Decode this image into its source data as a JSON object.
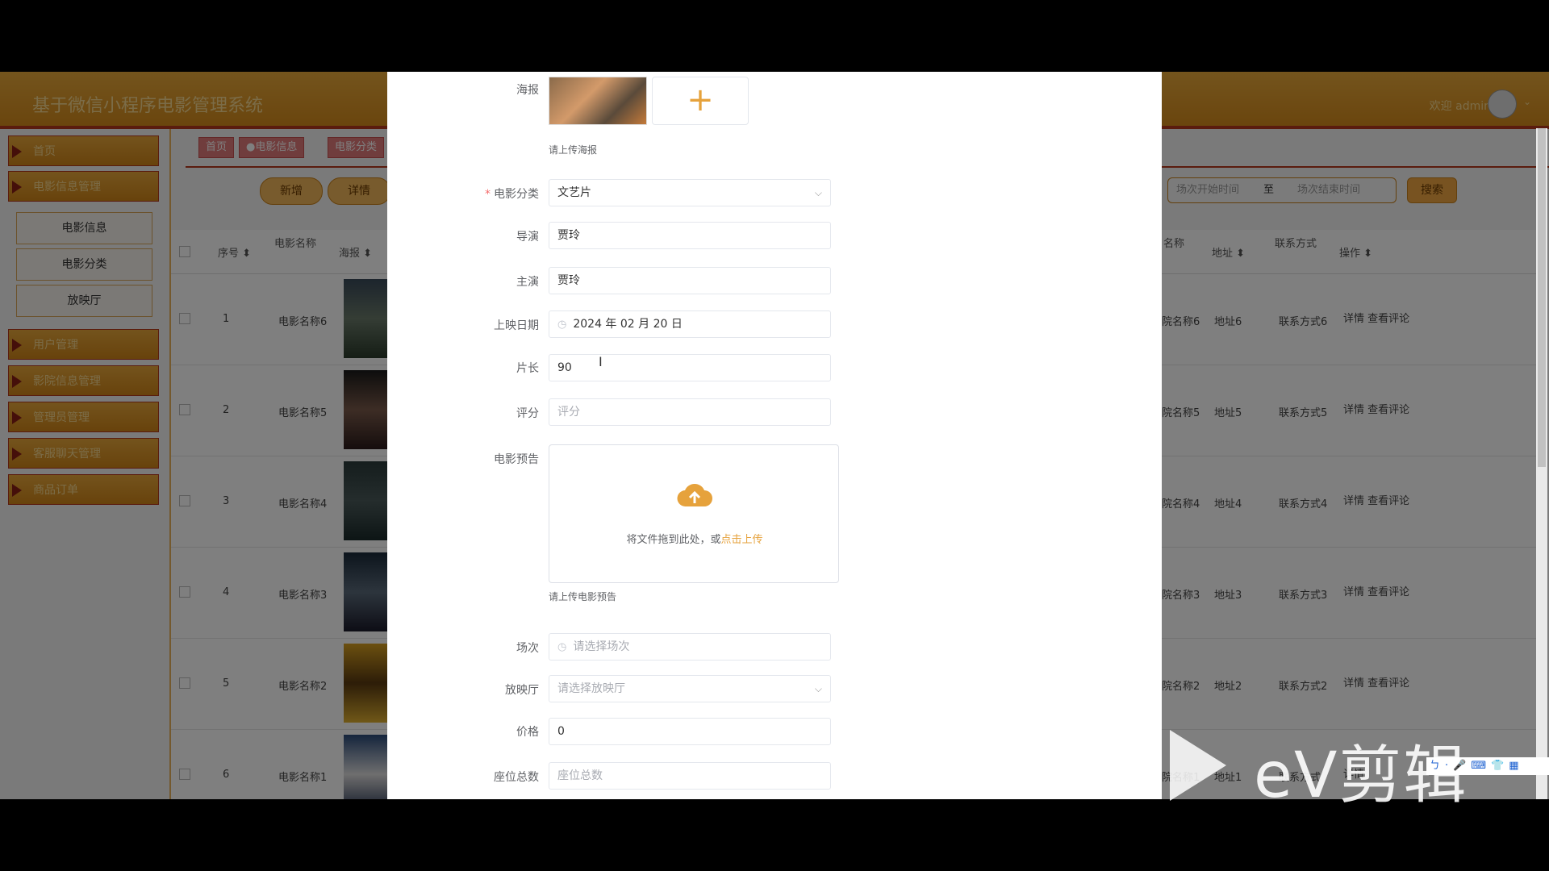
{
  "app": {
    "title": "基于微信小程序电影管理系统",
    "welcome": "欢迎 admin",
    "avatar_arrow": "⌄"
  },
  "sidebar": {
    "home": "首页",
    "movie_mgmt": "电影信息管理",
    "sub_items": [
      "电影信息",
      "电影分类",
      "放映厅"
    ],
    "user_mgmt": "用户管理",
    "cinema_mgmt": "影院信息管理",
    "admin_mgmt": "管理员管理",
    "chat_mgmt": "客服聊天管理",
    "orders": "商品订单"
  },
  "tabs": [
    "首页",
    "●电影信息",
    "电影分类"
  ],
  "toolbar": {
    "add": "新增",
    "detail": "详情",
    "start_placeholder": "场次开始时间",
    "to": "至",
    "end_placeholder": "场次结束时间",
    "search": "搜索"
  },
  "table": {
    "headers": {
      "index": "序号 ⬍",
      "name": "电影名称",
      "poster": "海报 ⬍",
      "cinema": "名称",
      "address": "地址 ⬍",
      "contact": "联系方式",
      "ops": "操作 ⬍"
    },
    "rows": [
      {
        "index": "1",
        "name": "电影名称6",
        "cinema": "院名称6",
        "address": "地址6",
        "contact": "联系方式6",
        "ops": "详情  查看评论"
      },
      {
        "index": "2",
        "name": "电影名称5",
        "cinema": "院名称5",
        "address": "地址5",
        "contact": "联系方式5",
        "ops": "详情  查看评论"
      },
      {
        "index": "3",
        "name": "电影名称4",
        "cinema": "院名称4",
        "address": "地址4",
        "contact": "联系方式4",
        "ops": "详情  查看评论"
      },
      {
        "index": "4",
        "name": "电影名称3",
        "cinema": "院名称3",
        "address": "地址3",
        "contact": "联系方式3",
        "ops": "详情  查看评论"
      },
      {
        "index": "5",
        "name": "电影名称2",
        "cinema": "院名称2",
        "address": "地址2",
        "contact": "联系方式2",
        "ops": "详情  查看评论"
      },
      {
        "index": "6",
        "name": "电影名称1",
        "cinema": "院名称1",
        "address": "地址1",
        "contact": "联系方式",
        "ops": "详情"
      }
    ]
  },
  "form": {
    "poster_label": "海报",
    "poster_hint": "请上传海报",
    "category_label": "电影分类",
    "category_value": "文艺片",
    "director_label": "导演",
    "director_value": "贾玲",
    "actor_label": "主演",
    "actor_value": "贾玲",
    "release_label": "上映日期",
    "release_value": "2024 年 02 月 20 日",
    "length_label": "片长",
    "length_value": "90",
    "rating_label": "评分",
    "rating_placeholder": "评分",
    "trailer_label": "电影预告",
    "trailer_drop_text": "将文件拖到此处，或",
    "trailer_drop_link": "点击上传",
    "trailer_hint": "请上传电影预告",
    "session_label": "场次",
    "session_placeholder": "请选择场次",
    "hall_label": "放映厅",
    "hall_placeholder": "请选择放映厅",
    "price_label": "价格",
    "price_value": "0",
    "seats_label": "座位总数",
    "seats_placeholder": "座位总数"
  },
  "watermark": {
    "text": "eV剪辑",
    "icons": "ㄅ·🎤⌨👕▦"
  },
  "colors": {
    "accent": "#e6a23c",
    "header": "#d58b1c",
    "border_red": "#b5381c",
    "required": "#f56c6c"
  }
}
